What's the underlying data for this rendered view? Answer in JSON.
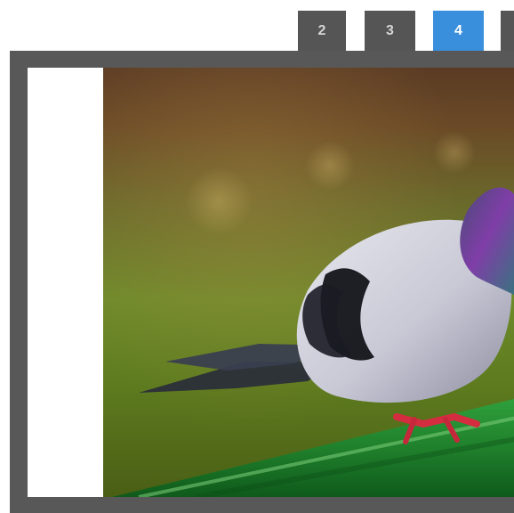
{
  "pagination": {
    "tabs": [
      {
        "label": "2",
        "active": false
      },
      {
        "label": "3",
        "active": false
      },
      {
        "label": "4",
        "active": true
      },
      {
        "label": "",
        "active": false
      }
    ],
    "colors": {
      "tab_bg": "#555555",
      "tab_active_bg": "#3a8fdc",
      "frame_bg": "#585858"
    }
  }
}
